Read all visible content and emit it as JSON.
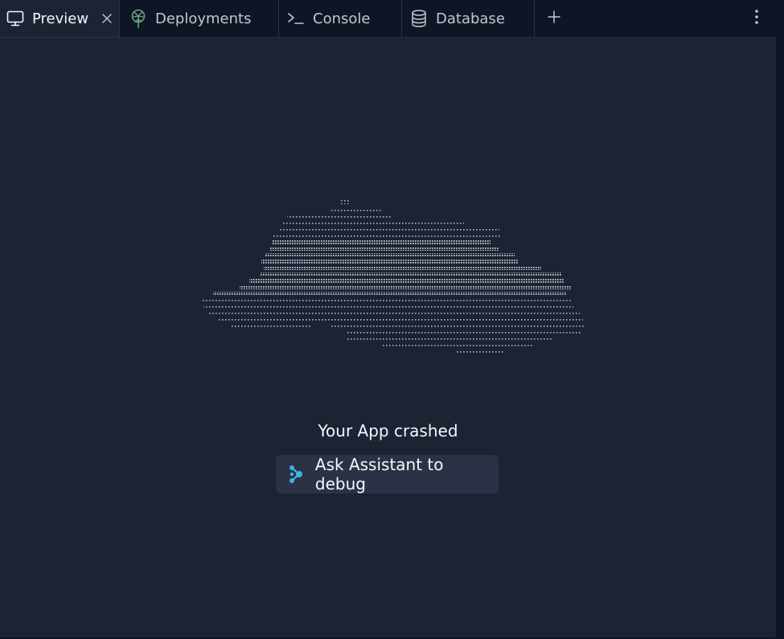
{
  "tabs": [
    {
      "label": "Preview",
      "icon": "monitor-icon",
      "active": true
    },
    {
      "label": "Deployments",
      "icon": "deployments-icon",
      "active": false
    },
    {
      "label": "Console",
      "icon": "terminal-icon",
      "active": false
    },
    {
      "label": "Database",
      "icon": "database-icon",
      "active": false
    }
  ],
  "toolbar": {
    "add_tab_icon": "plus-icon",
    "more_icon": "kebab-menu-icon"
  },
  "preview": {
    "art_icon": "cloud-ascii-art",
    "message": "Your App crashed",
    "debug_button_label": "Ask Assistant to debug",
    "debug_button_icon": "assistant-icon"
  },
  "colors": {
    "background": "#1c2333",
    "tabbar_background": "#0e1525",
    "button_background": "#2b3245",
    "text_primary": "#f5f9fc",
    "text_secondary": "#c2c8cc",
    "deploy_icon": "#6ba981",
    "assistant_icon": "#3cb4e6"
  }
}
